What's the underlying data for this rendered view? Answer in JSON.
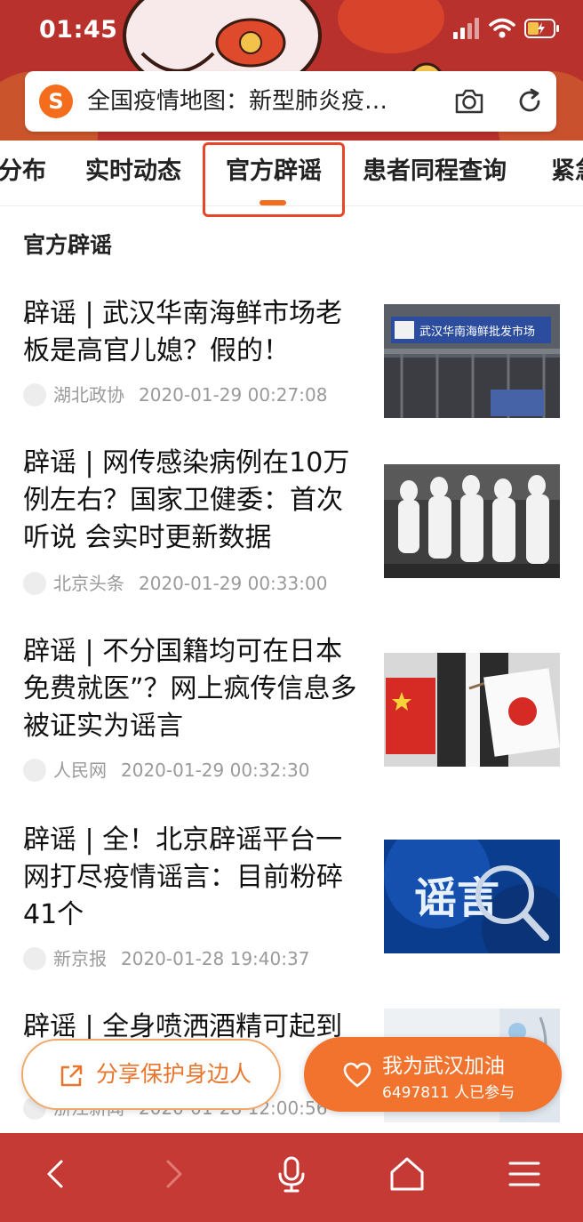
{
  "status_bar": {
    "time": "01:45"
  },
  "search_bar": {
    "logo_icon": "sogou-logo-icon",
    "logo_glyph": "S",
    "text": "全国疫情地图：新型肺炎疫…",
    "camera_icon": "camera-icon",
    "refresh_icon": "refresh-icon"
  },
  "tabs": [
    {
      "label": "分布"
    },
    {
      "label": "实时动态"
    },
    {
      "label": "官方辟谣",
      "active": true
    },
    {
      "label": "患者同程查询"
    },
    {
      "label": "紧急"
    }
  ],
  "section": {
    "title": "官方辟谣"
  },
  "articles": [
    {
      "title": "辟谣 | 武汉华南海鲜市场老板是高官儿媳？假的！",
      "source": "湖北政协",
      "time": "2020-01-29 00:27:08",
      "thumb_sign": "武汉华南海鲜批发市场"
    },
    {
      "title": "辟谣 | 网传感染病例在10万例左右？国家卫健委：首次听说 会实时更新数据",
      "source": "北京头条",
      "time": "2020-01-29 00:33:00"
    },
    {
      "title": "辟谣 | 不分国籍均可在日本免费就医”？网上疯传信息多被证实为谣言",
      "source": "人民网",
      "time": "2020-01-29 00:32:30"
    },
    {
      "title": "辟谣 | 全！北京辟谣平台一网打尽疫情谣言：目前粉碎41个",
      "source": "新京报",
      "time": "2020-01-28 19:40:37",
      "thumb_text": "谣言"
    },
    {
      "title": "辟谣 | 全身喷洒酒精可起到",
      "source": "浙江新闻",
      "time": "2020-01-28 12:00:56"
    }
  ],
  "actions": {
    "share_label": "分享保护身边人",
    "cheer_title": "我为武汉加油",
    "cheer_sub": "6497811 人已参与"
  },
  "colors": {
    "header_bg": "#b8312c",
    "accent_orange": "#f2732d",
    "highlight_red": "#e8462a",
    "bottom_nav_bg": "#c53a35"
  }
}
